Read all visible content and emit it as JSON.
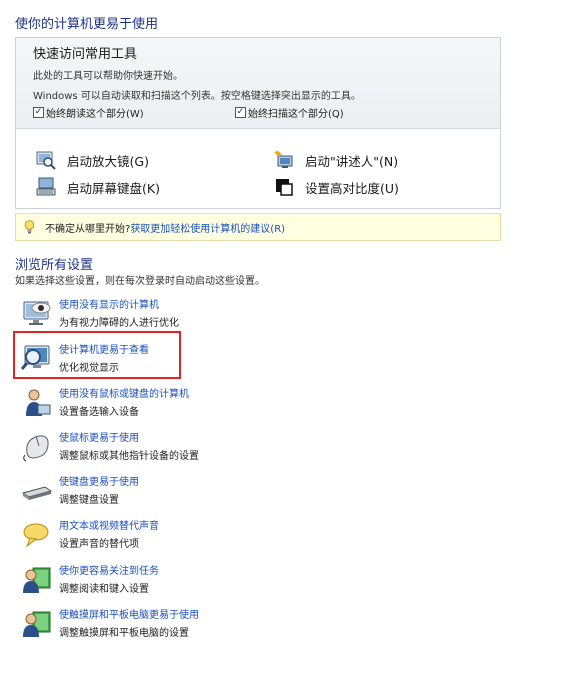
{
  "page_title": "使你的计算机更易于使用",
  "quick_access": {
    "title": "快速访问常用工具",
    "description": "此处的工具可以帮助你快速开始。",
    "description2": "Windows 可以自动读取和扫描这个列表。按空格键选择突出显示的工具。",
    "check_read": "始终朗读这个部分(W)",
    "check_scan": "始终扫描这个部分(Q)",
    "tools": [
      {
        "label": "启动放大镜(G)",
        "icon": "magnifier-icon"
      },
      {
        "label": "启动\"讲述人\"(N)",
        "icon": "narrator-icon"
      },
      {
        "label": "启动屏幕键盘(K)",
        "icon": "on-screen-keyboard-icon"
      },
      {
        "label": "设置高对比度(U)",
        "icon": "high-contrast-icon"
      }
    ]
  },
  "tip": {
    "question": "不确定从哪里开始?",
    "link": "获取更加轻松使用计算机的建议(R)",
    "icon": "lightbulb-icon"
  },
  "browse": {
    "title": "浏览所有设置",
    "description": "如果选择这些设置，则在每次登录时自动启动这些设置。",
    "items": [
      {
        "link": "使用没有显示的计算机",
        "desc": "为有视力障碍的人进行优化",
        "icon": "monitor-off-icon"
      },
      {
        "link": "使计算机更易于查看",
        "desc": "优化视觉显示",
        "icon": "magnify-display-icon"
      },
      {
        "link": "使用没有鼠标或键盘的计算机",
        "desc": "设置备选输入设备",
        "icon": "user-input-icon"
      },
      {
        "link": "使鼠标更易于使用",
        "desc": "调整鼠标或其他指针设备的设置",
        "icon": "mouse-icon"
      },
      {
        "link": "使键盘更易于使用",
        "desc": "调整键盘设置",
        "icon": "keyboard-icon"
      },
      {
        "link": "用文本或视频替代声音",
        "desc": "设置声音的替代项",
        "icon": "speech-bubble-icon"
      },
      {
        "link": "使你更容易关注到任务",
        "desc": "调整阅读和键入设置",
        "icon": "focus-task-icon"
      },
      {
        "link": "使触摸屏和平板电脑更易于使用",
        "desc": "调整触摸屏和平板电脑的设置",
        "icon": "touch-tablet-icon"
      }
    ]
  },
  "colors": {
    "heading": "#1e3287",
    "link": "#1a4fc0",
    "tip_bg": "#ffffe1",
    "highlight": "#e02323"
  }
}
